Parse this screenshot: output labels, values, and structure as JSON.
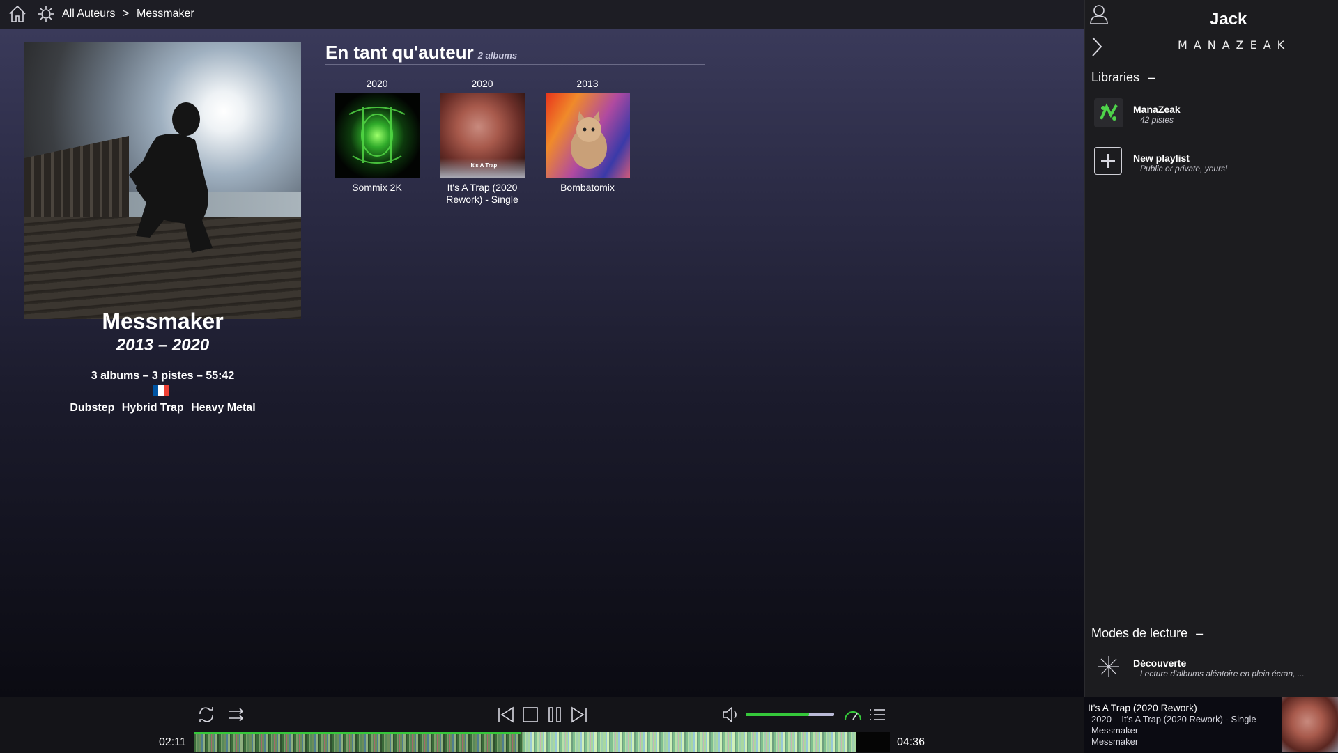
{
  "breadcrumb": {
    "root": "All Auteurs",
    "separator": ">",
    "current": "Messmaker"
  },
  "artist": {
    "name": "Messmaker",
    "years": "2013 – 2020",
    "stats": "3 albums – 3 pistes – 55:42",
    "country_flag_colors": [
      "#0055a4",
      "#ffffff",
      "#ef4135"
    ],
    "genres": [
      "Dubstep",
      "Hybrid Trap",
      "Heavy Metal"
    ]
  },
  "section": {
    "title": "En tant qu'auteur",
    "count": "2 albums"
  },
  "albums": [
    {
      "year": "2020",
      "title": "Sommix 2K"
    },
    {
      "year": "2020",
      "title": "It's A Trap (2020 Rework) - Single",
      "cover_text": "It's A Trap"
    },
    {
      "year": "2013",
      "title": "Bombatomix"
    }
  ],
  "user": {
    "name": "Jack",
    "app_logo": "MANAZEAK"
  },
  "libraries": {
    "heading": "Libraries",
    "toggle": "–",
    "items": [
      {
        "title": "ManaZeak",
        "subtitle": "42 pistes"
      },
      {
        "title": "New playlist",
        "subtitle": "Public or private, yours!"
      }
    ]
  },
  "modes": {
    "heading": "Modes de lecture",
    "toggle": "–",
    "items": [
      {
        "title": "Découverte",
        "subtitle": "Lecture d'albums aléatoire en plein écran, ..."
      }
    ]
  },
  "player": {
    "elapsed": "02:11",
    "duration": "04:36",
    "progress_fraction": 0.47,
    "volume_fraction": 0.72,
    "accent": "#35c83a"
  },
  "now_playing": {
    "title": "It's A Trap (2020 Rework)",
    "album_line": "2020 – It's A Trap (2020 Rework) - Single",
    "artist": "Messmaker",
    "composer": "Messmaker"
  },
  "icons": {
    "home": "home-icon",
    "settings": "gear-icon",
    "user": "user-icon",
    "collapse": "chevron-right-icon",
    "repeat": "repeat-icon",
    "shuffle": "shuffle-icon",
    "previous": "previous-icon",
    "stop": "stop-icon",
    "pause": "pause-icon",
    "next": "next-icon",
    "volume": "volume-icon",
    "speed": "speedometer-icon",
    "queue": "queue-list-icon"
  }
}
